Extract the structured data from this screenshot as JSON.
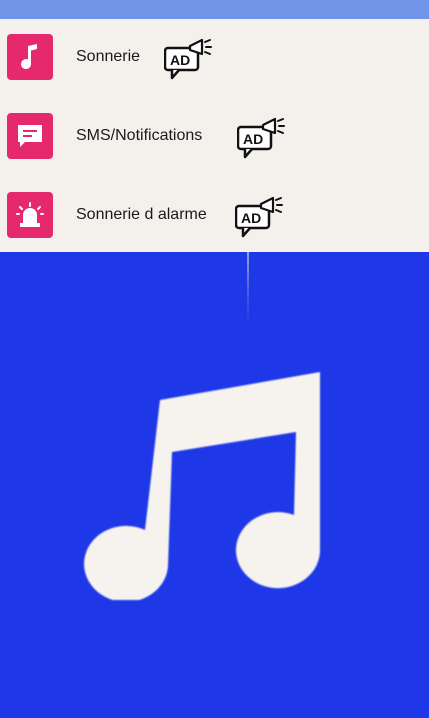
{
  "menu": {
    "items": [
      {
        "label": "Sonnerie",
        "icon": "music-note-icon",
        "badge": "AD"
      },
      {
        "label": "SMS/Notifications",
        "icon": "message-icon",
        "badge": "AD"
      },
      {
        "label": "Sonnerie d alarme",
        "icon": "alarm-siren-icon",
        "badge": "AD"
      }
    ]
  },
  "colors": {
    "accent": "#e6286c",
    "background": "#1e38e8",
    "topbar": "#7094e8",
    "menu_bg": "#f4f1ed"
  },
  "hero": {
    "icon": "music-note-icon"
  }
}
